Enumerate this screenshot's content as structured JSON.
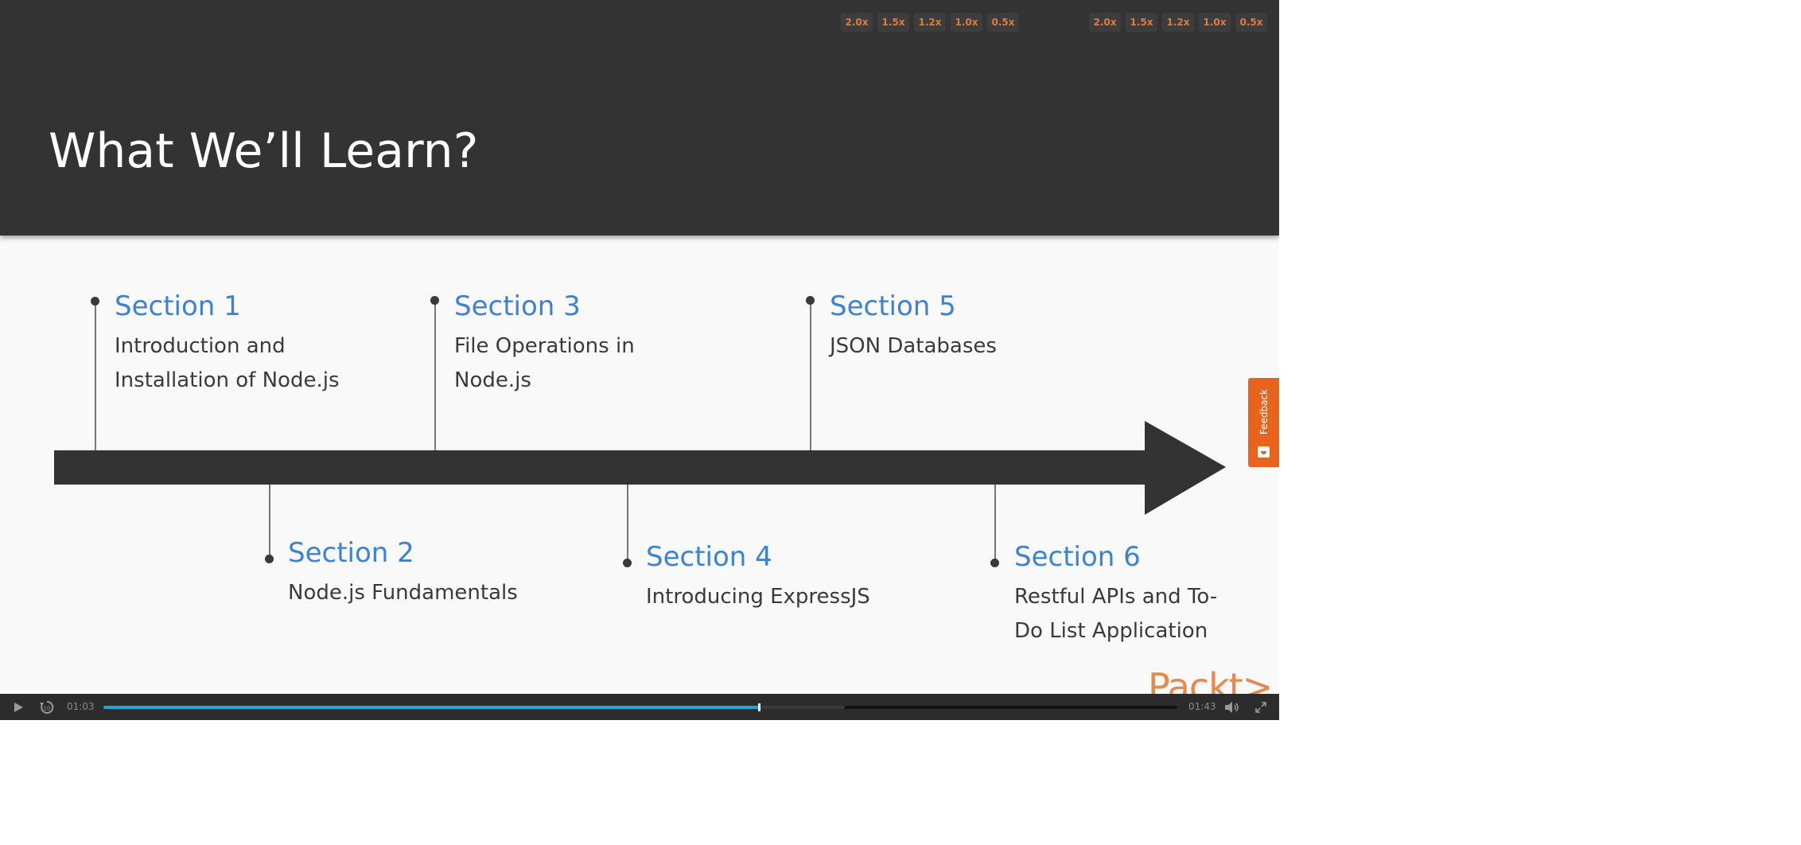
{
  "slide": {
    "title": "What We’ll Learn?",
    "sections": [
      {
        "title": "Section 1",
        "desc": [
          "Introduction and",
          "Installation of Node.js"
        ]
      },
      {
        "title": "Section 2",
        "desc": [
          "Node.js Fundamentals"
        ]
      },
      {
        "title": "Section 3",
        "desc": [
          "File Operations in",
          "Node.js"
        ]
      },
      {
        "title": "Section 4",
        "desc": [
          "Introducing ExpressJS"
        ]
      },
      {
        "title": "Section 5",
        "desc": [
          "JSON Databases"
        ]
      },
      {
        "title": "Section 6",
        "desc": [
          "Restful APIs and To-",
          "Do List Application"
        ]
      }
    ],
    "logo_text": "Packt>"
  },
  "speed_controls": {
    "group1": [
      "2.0x",
      "1.5x",
      "1.2x",
      "1.0x",
      "0.5x"
    ],
    "group2": [
      "2.0x",
      "1.5x",
      "1.2x",
      "1.0x",
      "0.5x"
    ]
  },
  "feedback": {
    "label": "Feedback",
    "icon": "feedback-icon"
  },
  "player": {
    "current_time": "01:03",
    "duration": "01:43",
    "played_fraction": 0.61,
    "buffered_fraction": 0.69,
    "icons": {
      "play": "play-icon",
      "replay": "replay-10-icon",
      "volume": "volume-icon",
      "fullscreen": "fullscreen-icon"
    }
  },
  "colors": {
    "header_bg": "#333333",
    "section_title": "#3b82d6",
    "accent_orange": "#e8641d",
    "progress": "#1fa7d9"
  }
}
